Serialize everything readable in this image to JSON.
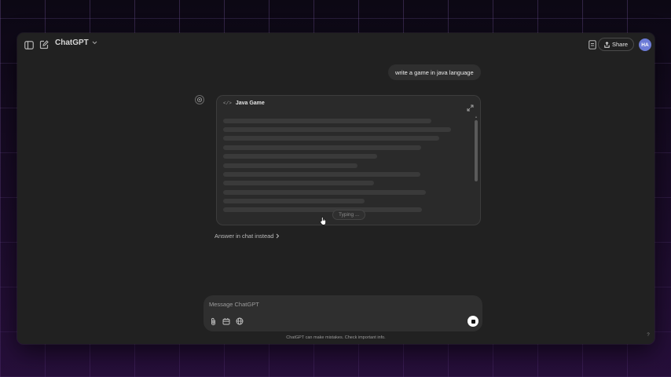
{
  "header": {
    "model_label": "ChatGPT",
    "share_label": "Share",
    "avatar_initials": "HA"
  },
  "user_message": "write a game in java language",
  "canvas": {
    "code_icon": "</>",
    "title": "Java Game",
    "status": "Typing ..."
  },
  "answer_in_chat": "Answer in chat instead",
  "composer": {
    "placeholder": "Message ChatGPT"
  },
  "footer_note": "ChatGPT can make mistakes. Check important info.",
  "help_label": "?",
  "icons": [
    "sidebar-toggle-icon",
    "new-chat-icon",
    "chevron-down-icon",
    "share-icon",
    "canvas-doc-icon",
    "assistant-logo-icon",
    "expand-icon",
    "paperclip-icon",
    "tools-icon",
    "globe-icon",
    "stop-icon",
    "mouse-cursor-icon"
  ],
  "colors": {
    "window_bg": "#212121",
    "bubble_bg": "#2f2f2f",
    "avatar_bg": "#6c7bd6",
    "stop_button": "#ffffff"
  }
}
